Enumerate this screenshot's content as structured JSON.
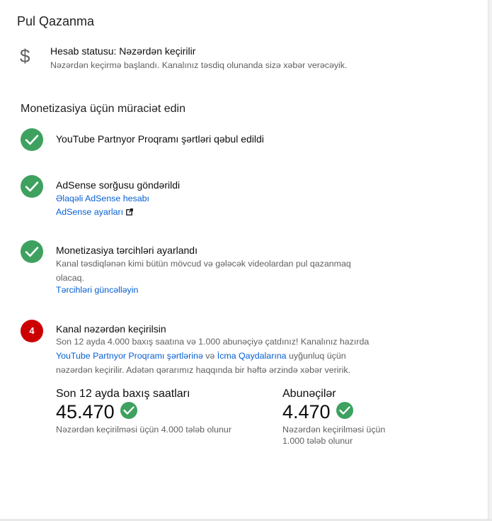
{
  "page": {
    "title": "Pul Qazanma"
  },
  "status": {
    "icon": "dollar-icon",
    "title": "Hesab statusu: Nəzərdən keçirilir",
    "description": "Nəzərdən keçirmə başlandı. Kanalınız təsdiq olunanda sizə xəbər verəcəyik."
  },
  "section": {
    "title": "Monetizasiya üçün müraciət edin"
  },
  "steps": {
    "ypp_terms": {
      "title": "YouTube Partnyor Proqramı şərtləri qəbul edildi"
    },
    "adsense": {
      "title": "AdSense sorğusu göndərildi",
      "linked_account_link": "Əlaqəli AdSense hesabı",
      "settings_link": "AdSense ayarları"
    },
    "preferences": {
      "title": "Monetizasiya tərcihləri ayarlandı",
      "line1": "Kanal təsdiqlənən kimi bütün mövcud və gələcək videolardan pul qazanmaq",
      "line2": "olacaq.",
      "update_link": "Tərcihləri güncəlləyin"
    },
    "review": {
      "number": "4",
      "title": "Kanal nəzərdən keçirilsin",
      "line1": "Son 12 ayda 4.000 baxış saatına və 1.000 abunəçiyə çatdınız! Kanalınız hazırda",
      "terms_link": "YouTube Partnyor Proqramı şərtlərinə",
      "and_text": " və ",
      "guidelines_link": "İcma Qaydalarına",
      "line2_tail": " uyğunluq üçün",
      "line3": "nəzərdən keçirilir. Adətən qərarımız haqqında bir həftə ərzində xəbər veririk."
    }
  },
  "metrics": {
    "watch_hours": {
      "label": "Son 12 ayda baxış saatları",
      "value": "45.470",
      "note": "Nəzərdən keçirilməsi üçün 4.000 tələb olunur"
    },
    "subscribers": {
      "label": "Abunəçilər",
      "value": "4.470",
      "note_line1": "Nəzərdən keçirilməsi üçün",
      "note_line2": "1.000 tələb olunur"
    }
  },
  "colors": {
    "success": "#3ea15f",
    "pending": "#cc0000",
    "link": "#065fd4",
    "secondary_text": "#606060"
  }
}
